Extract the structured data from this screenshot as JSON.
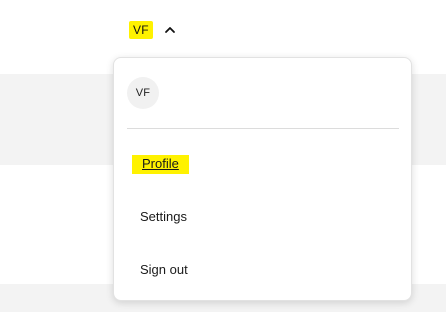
{
  "header": {
    "user_initials": "VF",
    "chevron_icon": "chevron-up-icon"
  },
  "menu": {
    "avatar_initials": "VF",
    "items": [
      {
        "label": "Profile",
        "highlighted": true
      },
      {
        "label": "Settings"
      },
      {
        "label": "Sign out"
      }
    ]
  },
  "colors": {
    "highlight": "#fff200",
    "page_band": "#f3f3f3"
  }
}
